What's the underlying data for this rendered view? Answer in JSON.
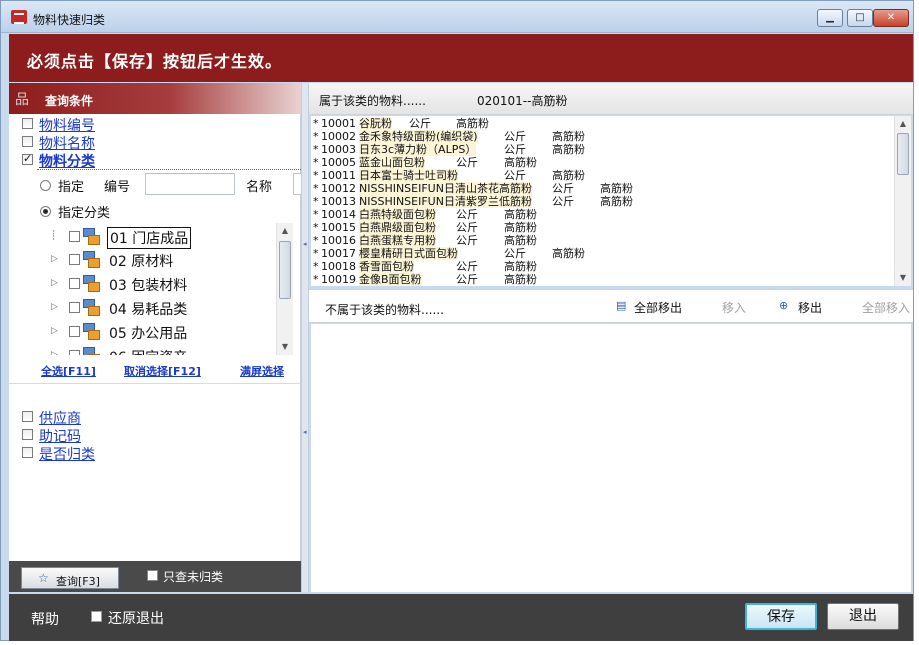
{
  "window": {
    "title": "物料快速归类"
  },
  "banner": {
    "notice": "必须点击【保存】按钮后才生效。"
  },
  "left": {
    "header": "查询条件",
    "filters_top": [
      {
        "label": "物料编号",
        "checked": false
      },
      {
        "label": "物料名称",
        "checked": false
      },
      {
        "label": "物料分类",
        "checked": true
      }
    ],
    "radio_specify": "指定",
    "code_label": "编号",
    "name_label": "名称",
    "code_value": "",
    "name_value": "",
    "radio_category": "指定分类",
    "tree": [
      {
        "label": "01 门店成品",
        "selected": true
      },
      {
        "label": "02 原材料",
        "selected": false
      },
      {
        "label": "03 包装材料",
        "selected": false
      },
      {
        "label": "04 易耗品类",
        "selected": false
      },
      {
        "label": "05 办公用品",
        "selected": false
      },
      {
        "label": "06 固定资产",
        "selected": false
      }
    ],
    "select_all": "全选[F11]",
    "deselect": "取消选择[F12]",
    "full_screen": "满屏选择",
    "filters_bottom": [
      {
        "label": "供应商",
        "checked": false
      },
      {
        "label": "助记码",
        "checked": false
      },
      {
        "label": "是否归类",
        "checked": false
      }
    ],
    "query_button": "查询[F3]",
    "only_unclassified": "只查未归类"
  },
  "right": {
    "belongs_label": "属于该类的物料......",
    "category": "020101--高筋粉",
    "materials": [
      {
        "mark": "*",
        "code": "10001",
        "name": "谷朊粉",
        "unit": "公斤",
        "category": "高筋粉"
      },
      {
        "mark": "*",
        "code": "10002",
        "name": "金禾象特级面粉(编织袋)",
        "unit": "公斤",
        "category": "高筋粉"
      },
      {
        "mark": "*",
        "code": "10003",
        "name": "日东3c薄力粉（ALPS）",
        "unit": "公斤",
        "category": "高筋粉"
      },
      {
        "mark": "*",
        "code": "10005",
        "name": "蓝金山面包粉",
        "unit": "公斤",
        "category": "高筋粉"
      },
      {
        "mark": "*",
        "code": "10011",
        "name": "日本富士骑士吐司粉",
        "unit": "公斤",
        "category": "高筋粉"
      },
      {
        "mark": "*",
        "code": "10012",
        "name": "NISSHINSEIFUN日清山茶花高筋粉",
        "unit": "公斤",
        "category": "高筋粉"
      },
      {
        "mark": "*",
        "code": "10013",
        "name": "NISSHINSEIFUN日清紫罗兰低筋粉",
        "unit": "公斤",
        "category": "高筋粉"
      },
      {
        "mark": "*",
        "code": "10014",
        "name": "白燕特级面包粉",
        "unit": "公斤",
        "category": "高筋粉"
      },
      {
        "mark": "*",
        "code": "10015",
        "name": "白燕鼎级面包粉",
        "unit": "公斤",
        "category": "高筋粉"
      },
      {
        "mark": "*",
        "code": "10016",
        "name": "白燕蛋糕专用粉",
        "unit": "公斤",
        "category": "高筋粉"
      },
      {
        "mark": "*",
        "code": "10017",
        "name": "樱皇精研日式面包粉",
        "unit": "公斤",
        "category": "高筋粉"
      },
      {
        "mark": "*",
        "code": "10018",
        "name": "香雪面包粉",
        "unit": "公斤",
        "category": "高筋粉"
      },
      {
        "mark": "*",
        "code": "10019",
        "name": "金像B面包粉",
        "unit": "公斤",
        "category": "高筋粉"
      }
    ],
    "not_belongs_label": "不属于该类的物料......",
    "toolbar": {
      "remove_all": "全部移出",
      "move_in": "移入",
      "remove": "移出",
      "move_all_in": "全部移入"
    }
  },
  "footer": {
    "help": "帮助",
    "restore_exit": "还原退出",
    "save": "保存",
    "exit": "退出"
  }
}
